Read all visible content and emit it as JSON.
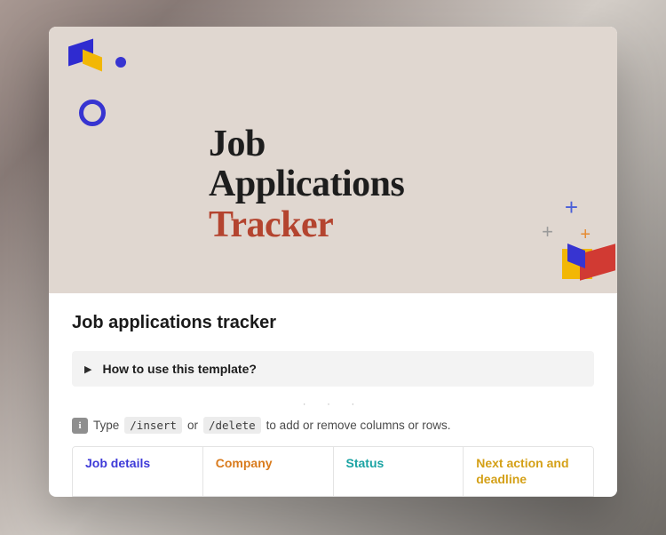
{
  "hero": {
    "line1": "Job",
    "line2": "Applications",
    "line3": "Tracker"
  },
  "page": {
    "title": "Job applications tracker"
  },
  "toggle": {
    "label": "How to use this template?"
  },
  "hint": {
    "prefix": "Type",
    "cmd_insert": "/insert",
    "joiner": "or",
    "cmd_delete": "/delete",
    "suffix": "to add or remove columns or rows."
  },
  "table": {
    "headers": [
      "Job details",
      "Company",
      "Status",
      "Next action and deadline"
    ]
  },
  "icons": {
    "info": "i"
  }
}
